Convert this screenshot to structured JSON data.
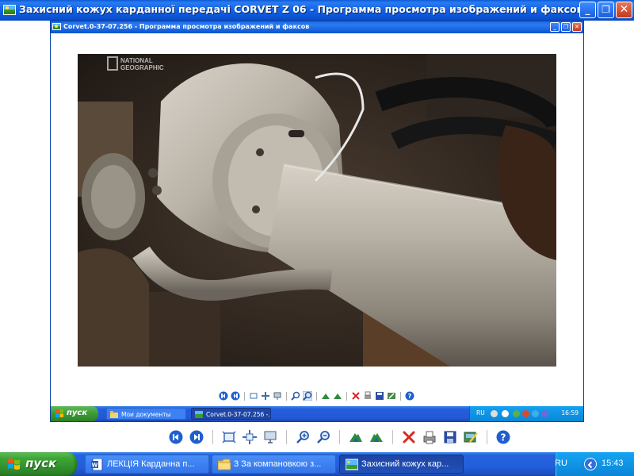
{
  "outer_window": {
    "title": "Захисний кожух карданної передачі CORVET Z 06 - Программа просмотра изображений и факсов",
    "controls": {
      "minimize": "_",
      "maximize": "❐",
      "close": "✕"
    }
  },
  "inner_window": {
    "title": "Corvet.0-37-07.256 - Программа просмотра изображений и факсов",
    "controls": {
      "minimize": "_",
      "maximize": "❐",
      "close": "✕"
    },
    "photo": {
      "watermark_line1": "NATIONAL",
      "watermark_line2": "GEOGRAPHIC"
    },
    "taskbar": {
      "start_label": "пуск",
      "tasks": [
        {
          "label": "Мои документы"
        },
        {
          "label": "Corvet.0-37-07.256 -..."
        }
      ],
      "tray": {
        "lang": "RU",
        "clock": "16:59"
      }
    }
  },
  "toolbar": {
    "buttons": [
      {
        "icon": "previous-image-icon"
      },
      {
        "icon": "next-image-icon"
      },
      {
        "icon": "best-fit-icon"
      },
      {
        "icon": "actual-size-icon"
      },
      {
        "icon": "slideshow-icon"
      },
      {
        "icon": "zoom-in-icon"
      },
      {
        "icon": "zoom-out-icon"
      },
      {
        "icon": "rotate-clockwise-icon"
      },
      {
        "icon": "rotate-counterclockwise-icon"
      },
      {
        "icon": "delete-icon"
      },
      {
        "icon": "print-icon"
      },
      {
        "icon": "save-icon"
      },
      {
        "icon": "edit-icon"
      },
      {
        "icon": "help-icon"
      }
    ]
  },
  "taskbar": {
    "start_label": "пуск",
    "tasks": [
      {
        "label": "ЛЕКЦІЯ Карданна п...",
        "icon": "word-document-icon",
        "active": false
      },
      {
        "label": "3 За компановкою з...",
        "icon": "folder-icon",
        "active": false
      },
      {
        "label": "Захисний кожух кар...",
        "icon": "image-viewer-icon",
        "active": true
      }
    ],
    "tray": {
      "lang": "RU",
      "clock": "15:43"
    }
  },
  "colors": {
    "titlebar_blue": "#0b52d1",
    "taskbar_blue": "#245edb",
    "start_green": "#3da635",
    "tray_blue": "#0f95e6",
    "close_red": "#c2391a"
  }
}
